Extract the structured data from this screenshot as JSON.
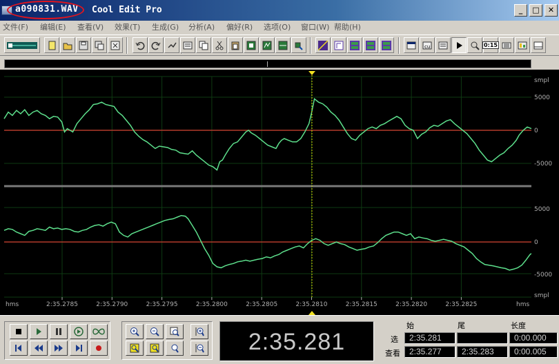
{
  "window": {
    "file_name": "a090831.WAV",
    "app_name": "Cool Edit Pro",
    "controls": [
      "_",
      "□",
      "✕"
    ]
  },
  "menu": [
    {
      "label": "文件(F)",
      "id": "file"
    },
    {
      "label": "编辑(E)",
      "id": "edit"
    },
    {
      "label": "查看(V)",
      "id": "view"
    },
    {
      "label": "效果(T)",
      "id": "effects"
    },
    {
      "label": "生成(G)",
      "id": "generate"
    },
    {
      "label": "分析(A)",
      "id": "analyze"
    },
    {
      "label": "偏好(R)",
      "id": "favorites"
    },
    {
      "label": "选项(O)",
      "id": "options"
    },
    {
      "label": "窗口(W)",
      "id": "window"
    },
    {
      "label": "帮助(H)",
      "id": "help"
    }
  ],
  "toolbar": {
    "buttons": [
      "multitrack-toggle-icon",
      "new-file-icon",
      "open-file-icon",
      "save-icon",
      "save-as-icon",
      "close-file-icon",
      "undo-icon",
      "redo-icon",
      "repeat-last-icon",
      "mix-paste-icon",
      "copy-icon",
      "cut-icon",
      "paste-icon",
      "paste-new-icon",
      "trim-icon",
      "silence-icon",
      "convert-icon",
      "envelope-icon",
      "amplify-icon",
      "fade-icon",
      "spectral-icon",
      "waveform-view-icon",
      "cue-list-icon",
      "play-list-icon",
      "play-icon",
      "zoom-info-icon",
      "time-icon",
      "cd-icon",
      "level-icon",
      "status-icon"
    ],
    "time_button_label": "0:15"
  },
  "waveform": {
    "channels": [
      {
        "name": "left-channel",
        "points": [
          [
            0,
            -0.35
          ],
          [
            6,
            -0.55
          ],
          [
            12,
            -0.45
          ],
          [
            18,
            -0.6
          ],
          [
            24,
            -0.5
          ],
          [
            30,
            -0.62
          ],
          [
            36,
            -0.45
          ],
          [
            42,
            -0.55
          ],
          [
            48,
            -0.6
          ],
          [
            54,
            -0.5
          ],
          [
            60,
            -0.45
          ],
          [
            66,
            -0.35
          ],
          [
            72,
            -0.42
          ],
          [
            78,
            -0.4
          ],
          [
            84,
            -0.25
          ],
          [
            88,
            0.05
          ],
          [
            92,
            -0.05
          ],
          [
            96,
            0.0
          ],
          [
            100,
            0.05
          ],
          [
            106,
            -0.2
          ],
          [
            112,
            -0.35
          ],
          [
            118,
            -0.5
          ],
          [
            124,
            -0.62
          ],
          [
            130,
            -0.78
          ],
          [
            136,
            -0.8
          ],
          [
            142,
            -0.85
          ],
          [
            148,
            -0.78
          ],
          [
            154,
            -0.75
          ],
          [
            160,
            -0.72
          ],
          [
            166,
            -0.55
          ],
          [
            172,
            -0.45
          ],
          [
            178,
            -0.3
          ],
          [
            184,
            -0.15
          ],
          [
            190,
            0.05
          ],
          [
            196,
            0.18
          ],
          [
            202,
            0.28
          ],
          [
            208,
            0.35
          ],
          [
            214,
            0.45
          ],
          [
            220,
            0.55
          ],
          [
            226,
            0.48
          ],
          [
            232,
            0.5
          ],
          [
            238,
            0.52
          ],
          [
            244,
            0.58
          ],
          [
            250,
            0.6
          ],
          [
            256,
            0.68
          ],
          [
            262,
            0.7
          ],
          [
            268,
            0.72
          ],
          [
            274,
            0.62
          ],
          [
            280,
            0.75
          ],
          [
            286,
            0.85
          ],
          [
            292,
            0.95
          ],
          [
            298,
            1.05
          ],
          [
            304,
            1.1
          ],
          [
            310,
            1.2
          ],
          [
            314,
            0.95
          ],
          [
            318,
            0.9
          ],
          [
            322,
            0.75
          ],
          [
            328,
            0.55
          ],
          [
            334,
            0.4
          ],
          [
            340,
            0.35
          ],
          [
            346,
            0.2
          ],
          [
            352,
            0.05
          ],
          [
            356,
            0.0
          ],
          [
            360,
            0.08
          ],
          [
            366,
            0.15
          ],
          [
            372,
            0.25
          ],
          [
            378,
            0.35
          ],
          [
            384,
            0.45
          ],
          [
            390,
            0.5
          ],
          [
            396,
            0.55
          ],
          [
            400,
            0.4
          ],
          [
            404,
            0.3
          ],
          [
            408,
            0.25
          ],
          [
            414,
            0.3
          ],
          [
            420,
            0.35
          ],
          [
            426,
            0.35
          ],
          [
            432,
            0.25
          ],
          [
            438,
            0.05
          ],
          [
            444,
            -0.2
          ],
          [
            448,
            -0.55
          ],
          [
            452,
            -0.95
          ],
          [
            458,
            -0.85
          ],
          [
            464,
            -0.8
          ],
          [
            470,
            -0.7
          ],
          [
            476,
            -0.55
          ],
          [
            482,
            -0.45
          ],
          [
            488,
            -0.3
          ],
          [
            494,
            -0.1
          ],
          [
            500,
            0.1
          ],
          [
            506,
            0.25
          ],
          [
            512,
            0.3
          ],
          [
            518,
            0.15
          ],
          [
            524,
            0.05
          ],
          [
            530,
            -0.05
          ],
          [
            536,
            -0.1
          ],
          [
            542,
            -0.05
          ],
          [
            548,
            -0.15
          ],
          [
            554,
            -0.2
          ],
          [
            560,
            -0.28
          ],
          [
            566,
            -0.35
          ],
          [
            572,
            -0.42
          ],
          [
            578,
            -0.35
          ],
          [
            584,
            -0.15
          ],
          [
            590,
            -0.05
          ],
          [
            596,
            0.0
          ],
          [
            602,
            0.25
          ],
          [
            608,
            0.12
          ],
          [
            614,
            0.05
          ],
          [
            620,
            -0.08
          ],
          [
            626,
            -0.15
          ],
          [
            632,
            -0.12
          ],
          [
            638,
            -0.2
          ],
          [
            644,
            -0.28
          ],
          [
            650,
            -0.32
          ],
          [
            656,
            -0.2
          ],
          [
            662,
            -0.1
          ],
          [
            668,
            0.0
          ],
          [
            674,
            0.1
          ],
          [
            680,
            0.25
          ],
          [
            686,
            0.4
          ],
          [
            692,
            0.6
          ],
          [
            698,
            0.75
          ],
          [
            704,
            0.9
          ],
          [
            710,
            0.95
          ],
          [
            716,
            0.85
          ],
          [
            722,
            0.75
          ],
          [
            728,
            0.68
          ],
          [
            734,
            0.55
          ],
          [
            740,
            0.45
          ],
          [
            746,
            0.3
          ],
          [
            750,
            0.15
          ],
          [
            756,
            0.0
          ],
          [
            762,
            -0.1
          ],
          [
            768,
            -0.05
          ]
        ]
      },
      {
        "name": "right-channel",
        "points": [
          [
            0,
            -0.35
          ],
          [
            6,
            -0.4
          ],
          [
            12,
            -0.38
          ],
          [
            18,
            -0.3
          ],
          [
            24,
            -0.25
          ],
          [
            30,
            -0.2
          ],
          [
            36,
            -0.32
          ],
          [
            42,
            -0.35
          ],
          [
            48,
            -0.4
          ],
          [
            54,
            -0.38
          ],
          [
            60,
            -0.35
          ],
          [
            66,
            -0.45
          ],
          [
            72,
            -0.4
          ],
          [
            78,
            -0.42
          ],
          [
            84,
            -0.38
          ],
          [
            90,
            -0.4
          ],
          [
            96,
            -0.38
          ],
          [
            102,
            -0.32
          ],
          [
            108,
            -0.3
          ],
          [
            114,
            -0.35
          ],
          [
            120,
            -0.38
          ],
          [
            126,
            -0.45
          ],
          [
            132,
            -0.5
          ],
          [
            138,
            -0.52
          ],
          [
            144,
            -0.48
          ],
          [
            150,
            -0.55
          ],
          [
            156,
            -0.6
          ],
          [
            162,
            -0.55
          ],
          [
            168,
            -0.3
          ],
          [
            174,
            -0.2
          ],
          [
            180,
            -0.15
          ],
          [
            186,
            -0.25
          ],
          [
            192,
            -0.3
          ],
          [
            198,
            -0.35
          ],
          [
            204,
            -0.4
          ],
          [
            210,
            -0.45
          ],
          [
            216,
            -0.5
          ],
          [
            222,
            -0.55
          ],
          [
            228,
            -0.6
          ],
          [
            234,
            -0.65
          ],
          [
            240,
            -0.68
          ],
          [
            246,
            -0.7
          ],
          [
            252,
            -0.75
          ],
          [
            258,
            -0.8
          ],
          [
            264,
            -0.78
          ],
          [
            268,
            -0.7
          ],
          [
            274,
            -0.5
          ],
          [
            280,
            -0.3
          ],
          [
            286,
            -0.05
          ],
          [
            292,
            0.2
          ],
          [
            298,
            0.4
          ],
          [
            304,
            0.65
          ],
          [
            310,
            0.75
          ],
          [
            316,
            0.78
          ],
          [
            322,
            0.72
          ],
          [
            328,
            0.68
          ],
          [
            334,
            0.65
          ],
          [
            340,
            0.6
          ],
          [
            346,
            0.58
          ],
          [
            352,
            0.55
          ],
          [
            358,
            0.58
          ],
          [
            364,
            0.55
          ],
          [
            370,
            0.52
          ],
          [
            376,
            0.5
          ],
          [
            382,
            0.45
          ],
          [
            388,
            0.48
          ],
          [
            394,
            0.42
          ],
          [
            400,
            0.38
          ],
          [
            406,
            0.3
          ],
          [
            412,
            0.25
          ],
          [
            418,
            0.2
          ],
          [
            424,
            0.15
          ],
          [
            430,
            0.12
          ],
          [
            436,
            0.18
          ],
          [
            442,
            0.05
          ],
          [
            448,
            -0.05
          ],
          [
            454,
            -0.1
          ],
          [
            460,
            -0.05
          ],
          [
            466,
            0.05
          ],
          [
            472,
            0.1
          ],
          [
            478,
            0.05
          ],
          [
            484,
            0.0
          ],
          [
            490,
            0.05
          ],
          [
            496,
            0.08
          ],
          [
            502,
            0.15
          ],
          [
            508,
            0.2
          ],
          [
            514,
            0.25
          ],
          [
            520,
            0.22
          ],
          [
            526,
            0.2
          ],
          [
            532,
            0.15
          ],
          [
            538,
            0.12
          ],
          [
            544,
            0.02
          ],
          [
            550,
            -0.1
          ],
          [
            556,
            -0.2
          ],
          [
            562,
            -0.25
          ],
          [
            568,
            -0.3
          ],
          [
            574,
            -0.3
          ],
          [
            580,
            -0.25
          ],
          [
            586,
            -0.2
          ],
          [
            592,
            -0.25
          ],
          [
            598,
            -0.1
          ],
          [
            604,
            -0.15
          ],
          [
            610,
            -0.12
          ],
          [
            616,
            -0.1
          ],
          [
            622,
            -0.05
          ],
          [
            628,
            -0.02
          ],
          [
            634,
            -0.05
          ],
          [
            640,
            -0.08
          ],
          [
            646,
            -0.05
          ],
          [
            652,
            -0.02
          ],
          [
            658,
            0.05
          ],
          [
            664,
            0.1
          ],
          [
            670,
            0.15
          ],
          [
            676,
            0.25
          ],
          [
            682,
            0.35
          ],
          [
            688,
            0.5
          ],
          [
            694,
            0.6
          ],
          [
            700,
            0.68
          ],
          [
            706,
            0.7
          ],
          [
            712,
            0.72
          ],
          [
            718,
            0.75
          ],
          [
            724,
            0.78
          ],
          [
            730,
            0.8
          ],
          [
            736,
            0.85
          ],
          [
            742,
            0.82
          ],
          [
            748,
            0.78
          ],
          [
            754,
            0.7
          ],
          [
            760,
            0.55
          ],
          [
            766,
            0.38
          ],
          [
            768,
            0.35
          ]
        ]
      }
    ],
    "amplitude_ticks": [
      "smpl",
      "5000",
      "0",
      "-5000",
      "smpl"
    ],
    "time_ruler": {
      "unit_label": "hms",
      "ticks": [
        "2:35.2785",
        "2:35.2790",
        "2:35.2795",
        "2:35.2800",
        "2:35.2805",
        "2:35.2810",
        "2:35.2815",
        "2:35.2820",
        "2:35.2825"
      ]
    },
    "colors": {
      "background": "#000000",
      "wave": "#5de08c",
      "center_line": "#b33a2a",
      "grid": "#0e3a12",
      "cursor": "#d8d800",
      "ruler_text": "#b0b0b0"
    }
  },
  "transport": {
    "buttons": [
      "stop-icon",
      "play-icon",
      "pause-icon",
      "play-looped-icon",
      "play-to-end-icon",
      "go-to-start-icon",
      "rewind-icon",
      "fast-forward-icon",
      "go-to-end-icon",
      "record-icon"
    ],
    "zoom_buttons": [
      "zoom-in-horizontal-icon",
      "zoom-out-horizontal-icon",
      "zoom-full-icon",
      "zoom-in-vertical-icon",
      "zoom-selection-icon",
      "zoom-left-edge-icon",
      "zoom-right-edge-icon",
      "zoom-out-vertical-icon"
    ]
  },
  "time_display": {
    "value": "2:35.281"
  },
  "selection_info": {
    "headers": [
      "始",
      "尾",
      "长度"
    ],
    "rows": [
      {
        "label": "选",
        "begin": "2:35.281",
        "end": "",
        "length": "0:00.000"
      },
      {
        "label": "查看",
        "begin": "2:35.277",
        "end": "2:35.283",
        "length": "0:00.005"
      }
    ]
  }
}
